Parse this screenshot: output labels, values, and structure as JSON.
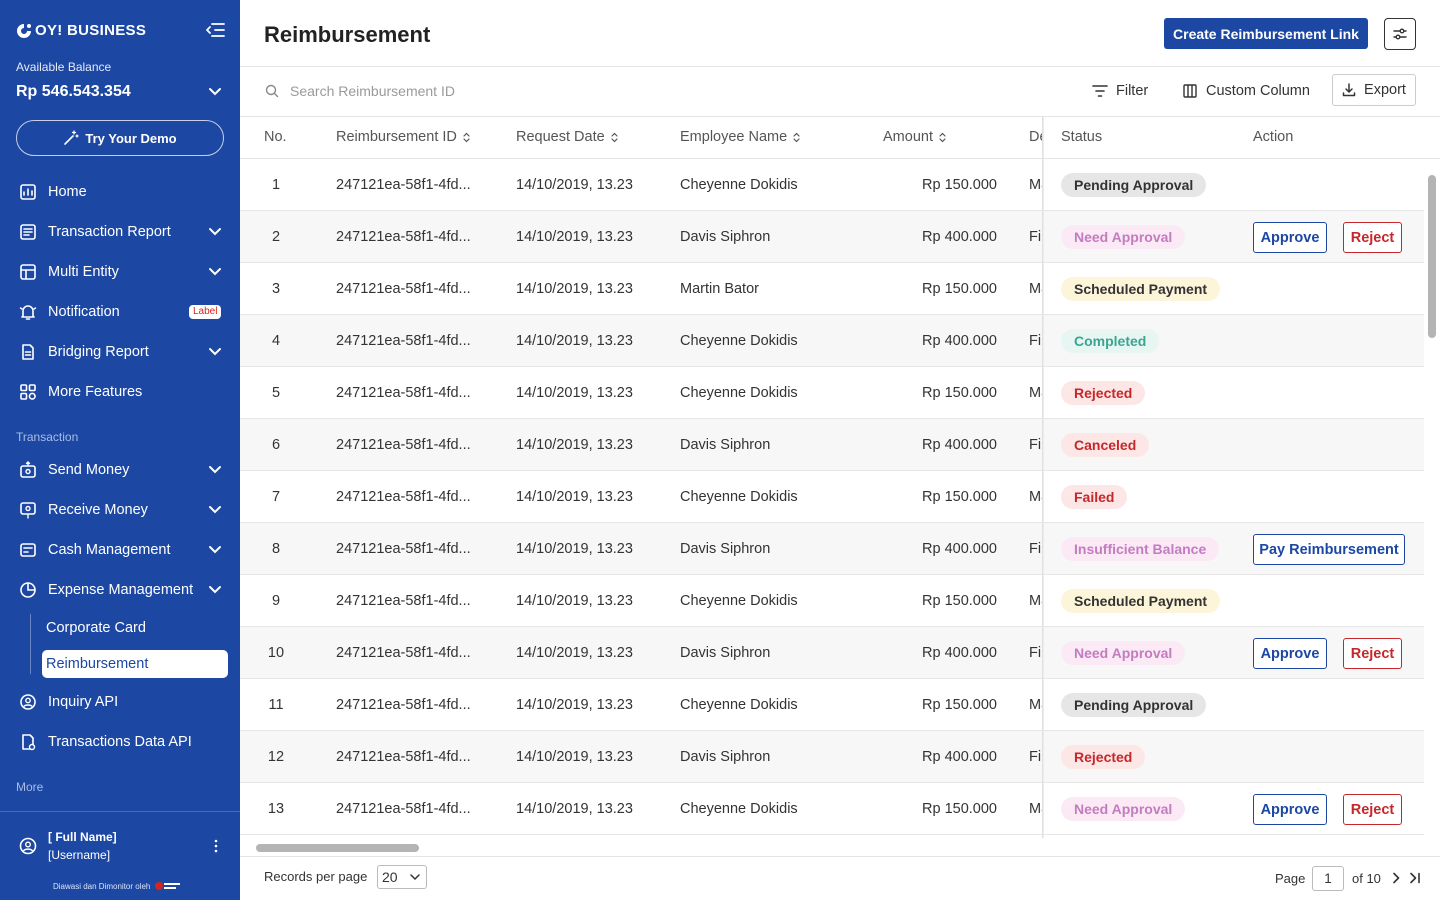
{
  "sidebar": {
    "brand": "OY! BUSINESS",
    "balance_label": "Available Balance",
    "balance_value": "Rp 546.543.354",
    "demo_button": "Try Your Demo",
    "nav": [
      {
        "label": "Home",
        "icon": "home-icon"
      },
      {
        "label": "Transaction Report",
        "icon": "report-icon"
      },
      {
        "label": "Multi Entity",
        "icon": "multi-entity-icon"
      },
      {
        "label": "Notification",
        "icon": "bell-icon",
        "badge": "Label"
      },
      {
        "label": "Bridging Report",
        "icon": "document-icon"
      },
      {
        "label": "More Features",
        "icon": "features-icon"
      }
    ],
    "section_transaction": "Transaction",
    "transaction_nav": [
      {
        "label": "Send Money",
        "icon": "send-money-icon"
      },
      {
        "label": "Receive Money",
        "icon": "receive-money-icon"
      },
      {
        "label": "Cash Management",
        "icon": "cash-management-icon"
      },
      {
        "label": "Expense Management",
        "icon": "expense-icon"
      }
    ],
    "expense_sub": [
      "Corporate Card",
      "Reimbursement"
    ],
    "api_nav": [
      {
        "label": "Inquiry API",
        "icon": "inquiry-api-icon"
      },
      {
        "label": "Transactions Data API",
        "icon": "data-api-icon"
      }
    ],
    "section_more": "More",
    "user_name": "[ Full Name]",
    "user_handle": "[Username]",
    "supervised": "Diawasi dan Dimonitor oleh"
  },
  "header": {
    "title": "Reimbursement",
    "create_button": "Create Reimbursement Link"
  },
  "toolbar": {
    "search_placeholder": "Search Reimbursement ID",
    "filter": "Filter",
    "custom_column": "Custom Column",
    "export": "Export"
  },
  "table": {
    "columns": {
      "no": "No.",
      "id": "Reimbursement ID",
      "date": "Request Date",
      "employee": "Employee Name",
      "amount": "Amount",
      "desc": "De",
      "status": "Status",
      "action": "Action"
    },
    "rows": [
      {
        "no": "1",
        "id": "247121ea-58f1-4fd...",
        "date": "14/10/2019, 13.23",
        "employee": "Cheyenne Dokidis",
        "amount": "Rp 150.000",
        "desc": "Ma",
        "status": "Pending Approval",
        "status_type": "pending",
        "actions": []
      },
      {
        "no": "2",
        "id": "247121ea-58f1-4fd...",
        "date": "14/10/2019, 13.23",
        "employee": "Davis Siphron",
        "amount": "Rp 400.000",
        "desc": "Fin",
        "status": "Need Approval",
        "status_type": "need",
        "actions": [
          "Approve",
          "Reject"
        ]
      },
      {
        "no": "3",
        "id": "247121ea-58f1-4fd...",
        "date": "14/10/2019, 13.23",
        "employee": "Martin Bator",
        "amount": "Rp 150.000",
        "desc": "Ma",
        "status": "Scheduled Payment",
        "status_type": "scheduled",
        "actions": []
      },
      {
        "no": "4",
        "id": "247121ea-58f1-4fd...",
        "date": "14/10/2019, 13.23",
        "employee": "Cheyenne Dokidis",
        "amount": "Rp 400.000",
        "desc": "Fin",
        "status": "Completed",
        "status_type": "completed",
        "actions": []
      },
      {
        "no": "5",
        "id": "247121ea-58f1-4fd...",
        "date": "14/10/2019, 13.23",
        "employee": "Cheyenne Dokidis",
        "amount": "Rp 150.000",
        "desc": "Ma",
        "status": "Rejected",
        "status_type": "rejected",
        "actions": []
      },
      {
        "no": "6",
        "id": "247121ea-58f1-4fd...",
        "date": "14/10/2019, 13.23",
        "employee": "Davis Siphron",
        "amount": "Rp 400.000",
        "desc": "Fin",
        "status": "Canceled",
        "status_type": "rejected",
        "actions": []
      },
      {
        "no": "7",
        "id": "247121ea-58f1-4fd...",
        "date": "14/10/2019, 13.23",
        "employee": "Cheyenne Dokidis",
        "amount": "Rp 150.000",
        "desc": "Ma",
        "status": "Failed",
        "status_type": "rejected",
        "actions": []
      },
      {
        "no": "8",
        "id": "247121ea-58f1-4fd...",
        "date": "14/10/2019, 13.23",
        "employee": "Davis Siphron",
        "amount": "Rp 400.000",
        "desc": "Fin",
        "status": "Insufficient Balance",
        "status_type": "need",
        "actions": [
          "Pay Reimbursement"
        ]
      },
      {
        "no": "9",
        "id": "247121ea-58f1-4fd...",
        "date": "14/10/2019, 13.23",
        "employee": "Cheyenne Dokidis",
        "amount": "Rp 150.000",
        "desc": "Ma",
        "status": "Scheduled Payment",
        "status_type": "scheduled",
        "actions": []
      },
      {
        "no": "10",
        "id": "247121ea-58f1-4fd...",
        "date": "14/10/2019, 13.23",
        "employee": "Davis Siphron",
        "amount": "Rp 400.000",
        "desc": "Fin",
        "status": "Need Approval",
        "status_type": "need",
        "actions": [
          "Approve",
          "Reject"
        ]
      },
      {
        "no": "11",
        "id": "247121ea-58f1-4fd...",
        "date": "14/10/2019, 13.23",
        "employee": "Cheyenne Dokidis",
        "amount": "Rp 150.000",
        "desc": "Ma",
        "status": "Pending Approval",
        "status_type": "pending",
        "actions": []
      },
      {
        "no": "12",
        "id": "247121ea-58f1-4fd...",
        "date": "14/10/2019, 13.23",
        "employee": "Davis Siphron",
        "amount": "Rp 400.000",
        "desc": "Fin",
        "status": "Rejected",
        "status_type": "rejected",
        "actions": []
      },
      {
        "no": "13",
        "id": "247121ea-58f1-4fd...",
        "date": "14/10/2019, 13.23",
        "employee": "Cheyenne Dokidis",
        "amount": "Rp 150.000",
        "desc": "Ma",
        "status": "Need Approval",
        "status_type": "need",
        "actions": [
          "Approve",
          "Reject"
        ]
      }
    ]
  },
  "pagination": {
    "records_label": "Records per page",
    "records_value": "20",
    "page_label": "Page",
    "page_value": "1",
    "of_label": "of 10"
  },
  "colors": {
    "brand": "#1c47a3",
    "status": {
      "pending": {
        "bg": "#e6e6e6",
        "fg": "#333333"
      },
      "need": {
        "bg": "#fbeaf5",
        "fg": "#c37cbf"
      },
      "scheduled": {
        "bg": "#fdf5d9",
        "fg": "#333333"
      },
      "completed": {
        "bg": "#e8f6f3",
        "fg": "#3aa68f"
      },
      "rejected": {
        "bg": "#fde6e6",
        "fg": "#c6272a"
      }
    }
  }
}
